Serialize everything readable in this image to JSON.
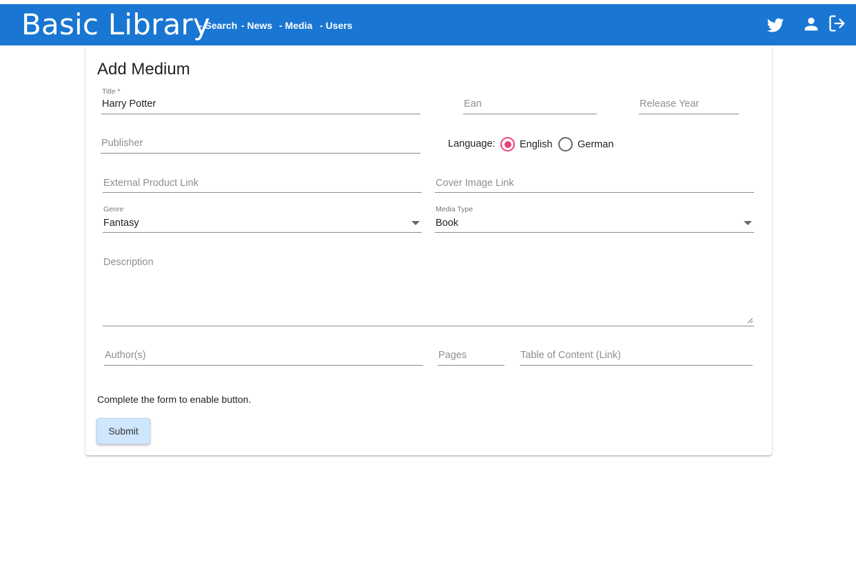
{
  "navbar": {
    "brand": "Basic Library",
    "links": [
      "- Search",
      "- News",
      "- Media",
      "- Users"
    ],
    "icons": [
      "twitter-icon",
      "account-icon",
      "logout-icon"
    ],
    "color": "#1976d2"
  },
  "form": {
    "heading": "Add Medium",
    "title": {
      "label": "Title *",
      "value": "Harry Potter"
    },
    "ean": {
      "placeholder": "Ean"
    },
    "release_year": {
      "placeholder": "Release Year"
    },
    "publisher": {
      "placeholder": "Publisher"
    },
    "language": {
      "label": "Language:",
      "options": [
        "English",
        "German"
      ],
      "selected": "English"
    },
    "external_link": {
      "placeholder": "External Product Link"
    },
    "cover_link": {
      "placeholder": "Cover Image Link"
    },
    "genre": {
      "label": "Genre",
      "value": "Fantasy"
    },
    "media_type": {
      "label": "Media Type",
      "value": "Book"
    },
    "description": {
      "placeholder": "Description"
    },
    "authors": {
      "placeholder": "Author(s)"
    },
    "pages": {
      "placeholder": "Pages"
    },
    "toc": {
      "placeholder": "Table of Content (Link)"
    },
    "hint": "Complete the form to enable button.",
    "submit_label": "Submit"
  },
  "colors": {
    "accent": "#ec407a",
    "button_bg": "#cfe6fd"
  }
}
